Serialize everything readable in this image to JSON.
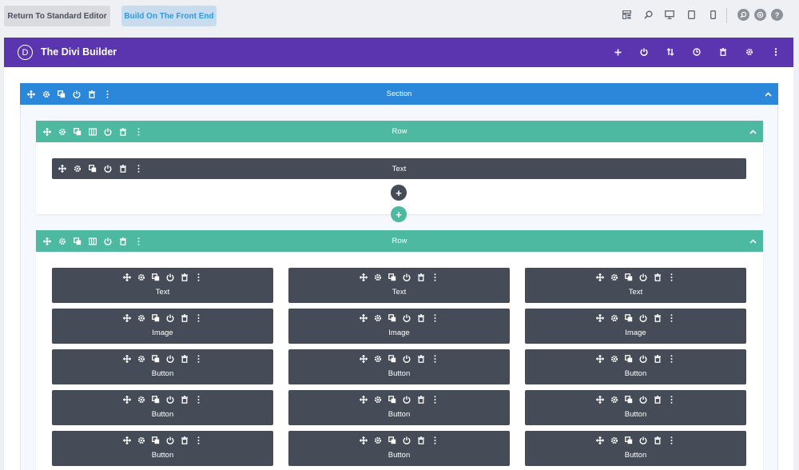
{
  "toolbar": {
    "return_label": "Return To Standard Editor",
    "front_label": "Build On The Front End",
    "view_icons": [
      "layout-icon",
      "zoom-icon",
      "desktop-icon",
      "tablet-icon",
      "phone-icon"
    ],
    "circle_icons": [
      "search-icon",
      "settings-icon",
      "help-icon"
    ],
    "help_glyph": "?"
  },
  "builder": {
    "logo_letter": "D",
    "title": "The Divi Builder",
    "header_icons": [
      "add-icon",
      "power-icon",
      "sort-icon",
      "history-icon",
      "trash-icon",
      "gear-icon",
      "more-icon"
    ]
  },
  "section": {
    "label": "Section",
    "color": "#2b87da"
  },
  "rows": [
    {
      "label": "Row",
      "color": "#4cb9a0",
      "modules": [
        {
          "label": "Text"
        }
      ]
    },
    {
      "label": "Row",
      "color": "#4cb9a0",
      "columns": [
        [
          "Text",
          "Image",
          "Button",
          "Button",
          "Button"
        ],
        [
          "Text",
          "Image",
          "Button",
          "Button",
          "Button"
        ],
        [
          "Text",
          "Image",
          "Button",
          "Button",
          "Button"
        ]
      ]
    }
  ],
  "add_glyph": "+",
  "colors": {
    "header": "#5b35b0",
    "module": "#454c57",
    "row": "#4cb9a0",
    "section": "#2b87da"
  }
}
